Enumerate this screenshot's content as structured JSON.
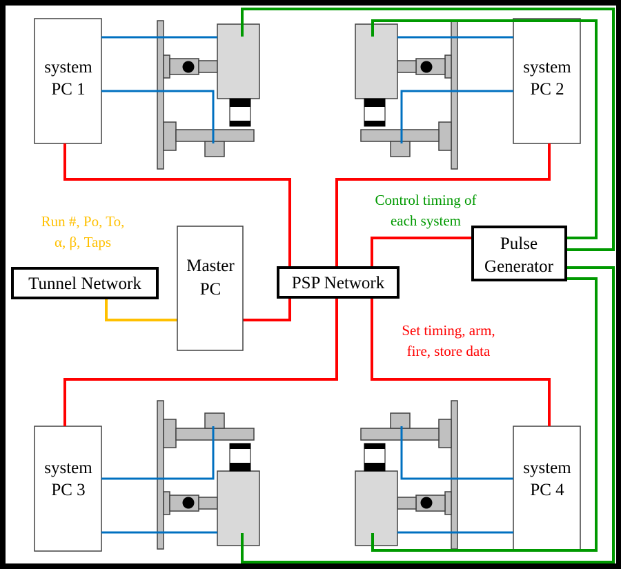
{
  "systems": [
    {
      "line1": "system",
      "line2": "PC 1"
    },
    {
      "line1": "system",
      "line2": "PC 2"
    },
    {
      "line1": "system",
      "line2": "PC 3"
    },
    {
      "line1": "system",
      "line2": "PC 4"
    }
  ],
  "master_pc": {
    "line1": "Master",
    "line2": "PC"
  },
  "psp_network": "PSP Network",
  "tunnel_network": "Tunnel Network",
  "pulse_generator": {
    "line1": "Pulse",
    "line2": "Generator"
  },
  "annotations": {
    "tunnel_params": {
      "line1": "Run #, Po, To,",
      "line2": "α, β, Taps",
      "color": "#FFC000"
    },
    "pulse_control": {
      "line1": "Control timing of",
      "line2": "each system",
      "color": "#009900"
    },
    "psp_control": {
      "line1": "Set timing, arm,",
      "line2": "fire, store data",
      "color": "#FF0000"
    }
  },
  "colors": {
    "psp_link": "#FF0000",
    "tunnel_link": "#FFC000",
    "trigger_link": "#009900",
    "camera_cable": "#0070C0"
  }
}
